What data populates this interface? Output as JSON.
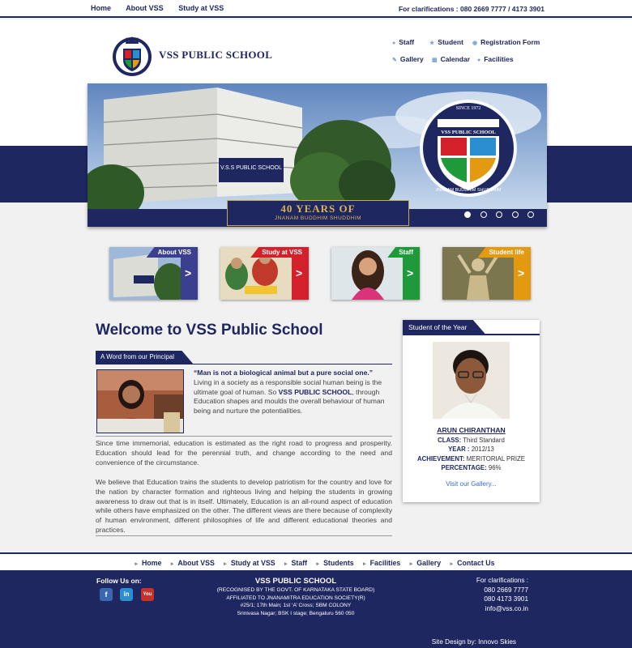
{
  "topbar": {
    "menu": [
      "Home",
      "About VSS",
      "Study at VSS"
    ],
    "clarifications": "For clarifications : 080 2669 7777 / 4173 3901"
  },
  "header": {
    "school_name": "VSS PUBLIC SCHOOL",
    "quick_links": [
      {
        "label": "Staff",
        "icon": "bullet-icon"
      },
      {
        "label": "Student",
        "icon": "star-icon"
      },
      {
        "label": "Registration Form",
        "icon": "globe-icon"
      },
      {
        "label": "Gallery",
        "icon": "brush-icon"
      },
      {
        "label": "Calendar",
        "icon": "calendar-icon"
      },
      {
        "label": "Facilities",
        "icon": "bullet-icon"
      }
    ]
  },
  "hero": {
    "caption_big": "40 YEARS OF",
    "caption_small": "JNANAM BUDDHIM SHUDDHIM",
    "crest_title": "VSS PUBLIC SCHOOL",
    "crest_since": "SINCE 1972",
    "crest_motto": "JNANAM BUDDHIM SHUDDHIM",
    "building_sign": "V.S.S PUBLIC SCHOOL",
    "active_slide": 1,
    "slide_count": 5
  },
  "tiles": [
    {
      "label": "About VSS",
      "color": "#3b3f8f"
    },
    {
      "label": "Study at VSS",
      "color": "#d3202a"
    },
    {
      "label": "Staff",
      "color": "#1e9a3b"
    },
    {
      "label": "Student life",
      "color": "#e39a10"
    }
  ],
  "main": {
    "welcome": "Welcome to VSS Public School",
    "word_tab": "A Word from our Principal",
    "quote_bold": "“Man is not a biological animal but a pure social one.”",
    "quote_text_1": "Living in a society as a responsible social human being is the ultimate goal of human. So ",
    "quote_school": "VSS PUBLIC SCHOOL",
    "quote_text_2": ", through Education shapes and moulds the overall behaviour of human being and nurture the potentialities.",
    "para1": "Since time immemorial, education is estimated as the right road to progress and prosperity. Education should lead for the perennial truth, and change according to the need and convenience of the circumstance.",
    "para2": "We believe that Education trains the students to develop patriotism for the country and love for the nation by character formation and righteous living and helping the students in growing awareness to draw out that is in itself. Ultimately, Education is an all-round aspect of education while others have emphasized on the other. The different views are there because of complexity of human environment, different philosophies of life and different educational theories and practices."
  },
  "student_of_year": {
    "tab": "Student of the Year",
    "name": "ARUN CHIRANTHAN",
    "class_label": "CLASS:",
    "class_value": "Third Standard",
    "year_label": "YEAR :",
    "year_value": "2012/13",
    "achievement_label": "ACHIEVEMENT:",
    "achievement_value": "MERITORIAL PRIZE",
    "percentage_label": "PERCENTAGE:",
    "percentage_value": "96%",
    "gallery_link": "Visit our Gallery..."
  },
  "footer_nav": [
    "Home",
    "About VSS",
    "Study at VSS",
    "Staff",
    "Students",
    "Facilities",
    "Gallery",
    "Contact Us"
  ],
  "footer": {
    "follow": "Follow Us on:",
    "social": [
      {
        "icon": "facebook-icon",
        "glyph": "f",
        "color": "#3b66b0"
      },
      {
        "icon": "linkedin-icon",
        "glyph": "in",
        "color": "#2a8ed0"
      },
      {
        "icon": "youtube-icon",
        "glyph": "You",
        "color": "#c8302a"
      }
    ],
    "title": "VSS PUBLIC SCHOOL",
    "address": [
      "(RECOGNISED BY THE GOVT. OF KARNATAKA STATE BOARD)",
      "AFFILIATED TO JNANAMITRA EDUCATION SOCIETY(R)",
      "#25/1; 17th Main; 1st ‘A’ Cross; SBM COLONY",
      "Srinivasa Nagar; BSK I stage; Bengaluru 560 050"
    ],
    "contact_title": "For clarifications :",
    "phone1": "080 2669 7777",
    "phone2": "080 4173 3901",
    "email": "info@vss.co.in",
    "credit": "Site Design by: Innovo Skies"
  }
}
